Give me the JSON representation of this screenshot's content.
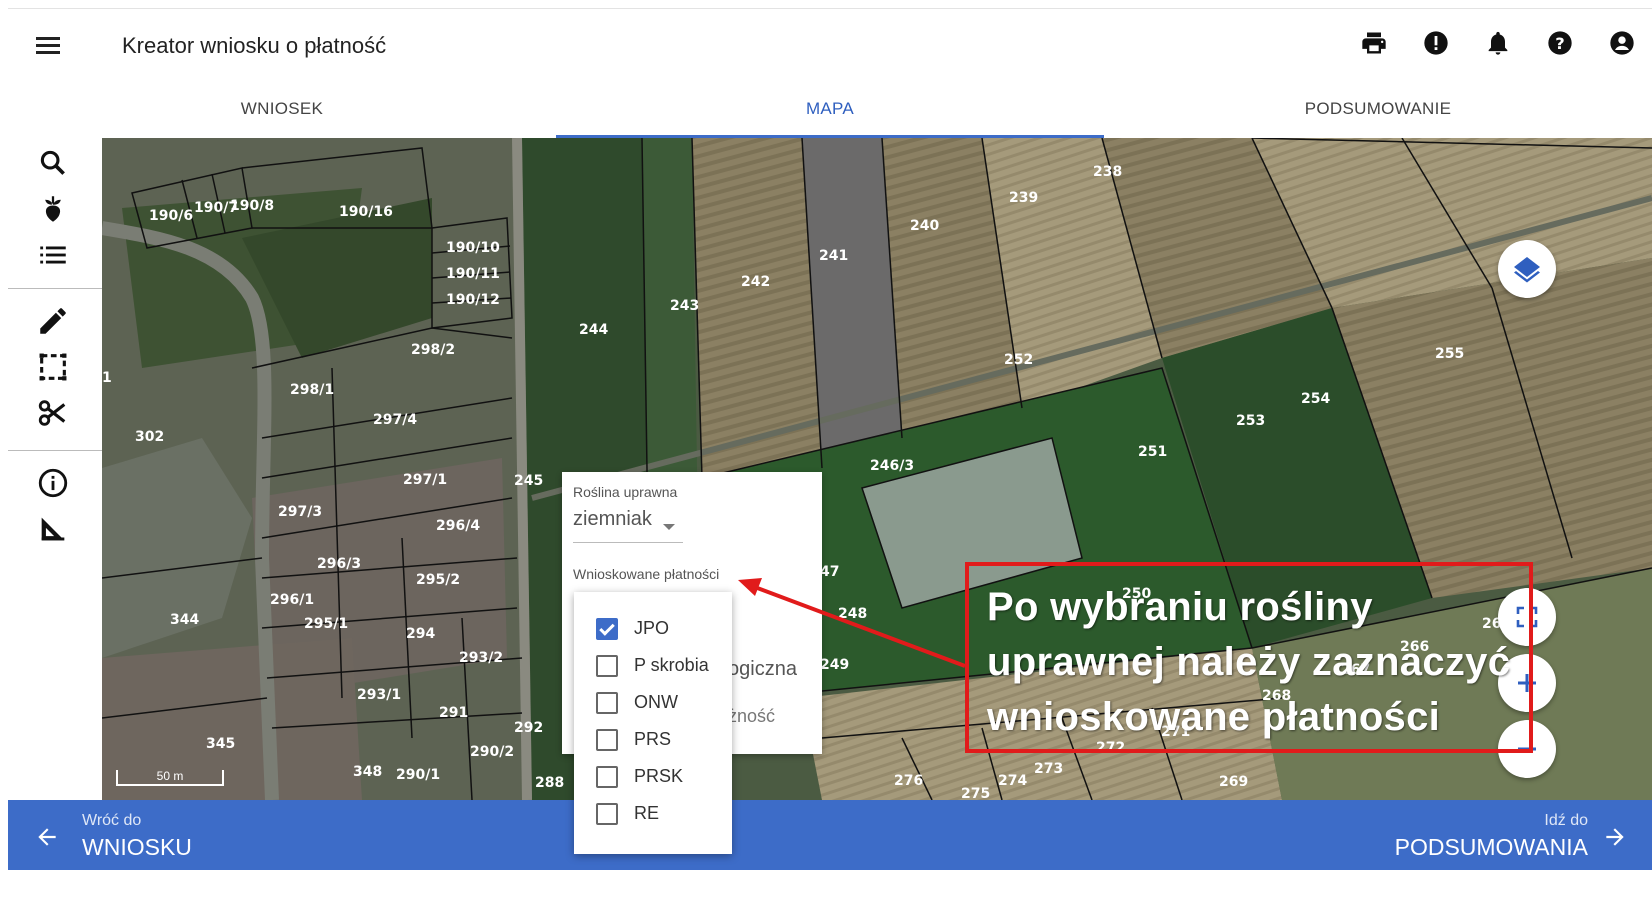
{
  "header": {
    "title": "Kreator wniosku o płatność",
    "icons": [
      "printer-icon",
      "alert-icon",
      "bell-icon",
      "help-icon",
      "account-icon"
    ]
  },
  "tabs": [
    {
      "label": "WNIOSEK",
      "active": false
    },
    {
      "label": "MAPA",
      "active": true
    },
    {
      "label": "PODSUMOWANIE",
      "active": false
    }
  ],
  "sidebar": {
    "tools": [
      "search-icon",
      "plant-icon",
      "list-icon",
      "pencil-icon",
      "select-area-icon",
      "scissors-icon",
      "info-icon",
      "measure-icon"
    ]
  },
  "map": {
    "parcels": [
      {
        "label": "190/6"
      },
      {
        "label": "190/7"
      },
      {
        "label": "190/8"
      },
      {
        "label": "190/16"
      },
      {
        "label": "190/10"
      },
      {
        "label": "190/11"
      },
      {
        "label": "190/12"
      },
      {
        "label": "298/2"
      },
      {
        "label": "298/1"
      },
      {
        "label": "297/4"
      },
      {
        "label": "297/1"
      },
      {
        "label": "297/3"
      },
      {
        "label": "296/4"
      },
      {
        "label": "296/3"
      },
      {
        "label": "296/1"
      },
      {
        "label": "295/2"
      },
      {
        "label": "295/1"
      },
      {
        "label": "294"
      },
      {
        "label": "293/2"
      },
      {
        "label": "293/1"
      },
      {
        "label": "292"
      },
      {
        "label": "291"
      },
      {
        "label": "290/2"
      },
      {
        "label": "290/1"
      },
      {
        "label": "288"
      },
      {
        "label": "302"
      },
      {
        "label": "344"
      },
      {
        "label": "345"
      },
      {
        "label": "348"
      },
      {
        "label": "243"
      },
      {
        "label": "244"
      },
      {
        "label": "242"
      },
      {
        "label": "241"
      },
      {
        "label": "240"
      },
      {
        "label": "239"
      },
      {
        "label": "238"
      },
      {
        "label": "245"
      },
      {
        "label": "246/3"
      },
      {
        "label": "252"
      },
      {
        "label": "251"
      },
      {
        "label": "253"
      },
      {
        "label": "254"
      },
      {
        "label": "255"
      },
      {
        "label": "47"
      },
      {
        "label": "248"
      },
      {
        "label": "249"
      },
      {
        "label": "250"
      },
      {
        "label": "276"
      },
      {
        "label": "275"
      },
      {
        "label": "274"
      },
      {
        "label": "273"
      },
      {
        "label": "272"
      },
      {
        "label": "271"
      },
      {
        "label": "269"
      },
      {
        "label": "268"
      },
      {
        "label": "267"
      },
      {
        "label": "266"
      },
      {
        "label": "26"
      },
      {
        "label": "1"
      }
    ],
    "scale_label": "50 m"
  },
  "panel": {
    "crop_label": "Roślina uprawna",
    "crop_value": "ziemniak",
    "payments_label": "Wnioskowane płatności",
    "bg_text_1": "ogiczna",
    "bg_text_2": "żność"
  },
  "payments": [
    {
      "label": "JPO",
      "checked": true
    },
    {
      "label": "P skrobia",
      "checked": false
    },
    {
      "label": "ONW",
      "checked": false
    },
    {
      "label": "PRS",
      "checked": false
    },
    {
      "label": "PRSK",
      "checked": false
    },
    {
      "label": "RE",
      "checked": false
    }
  ],
  "annotation": {
    "lines": [
      "Po wybraniu rośliny",
      "uprawnej należy zaznaczyć",
      "wnioskowane płatności"
    ],
    "color": "#e11b1b"
  },
  "footer": {
    "back_small": "Wróć do",
    "back_big": "WNIOSKU",
    "next_small": "Idź do",
    "next_big": "PODSUMOWANIA"
  },
  "colors": {
    "accent": "#3d6cc8"
  }
}
